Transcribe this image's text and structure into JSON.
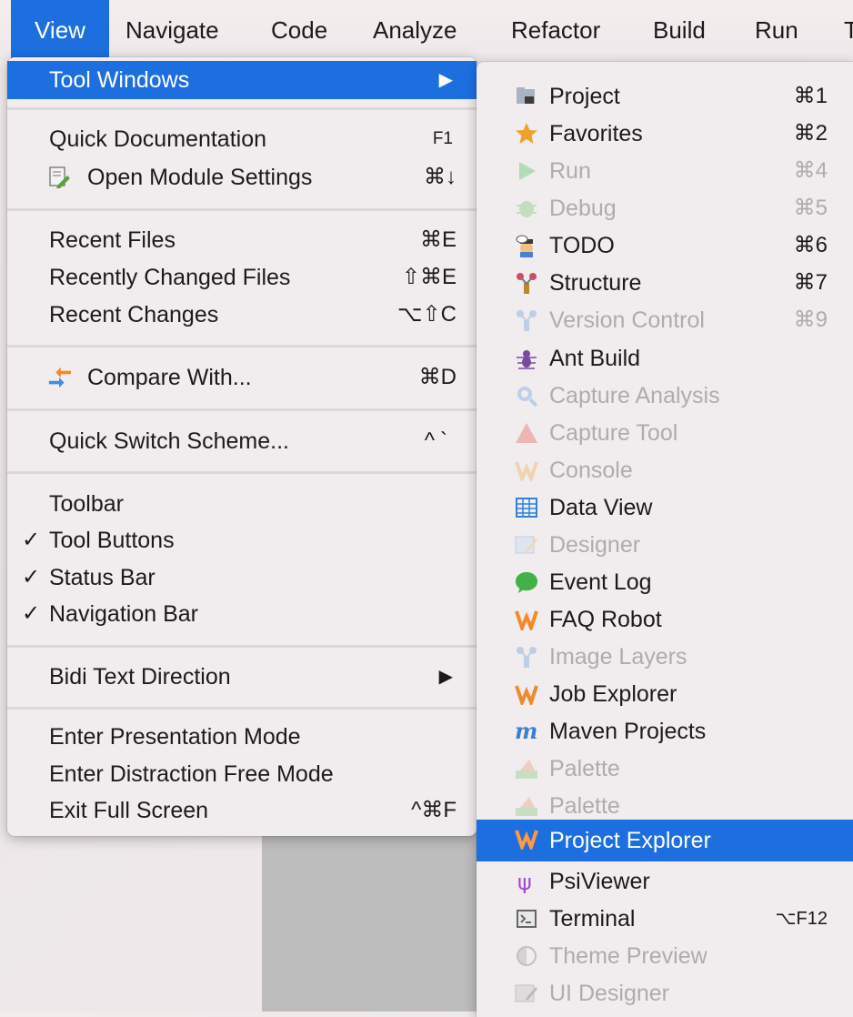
{
  "menubar": {
    "items": [
      "View",
      "Navigate",
      "Code",
      "Analyze",
      "Refactor",
      "Build",
      "Run",
      "T"
    ]
  },
  "view_menu": {
    "tool_windows": {
      "label": "Tool Windows"
    },
    "quick_documentation": {
      "label": "Quick Documentation",
      "shortcut": "F1"
    },
    "open_module_settings": {
      "label": "Open Module Settings",
      "shortcut": "⌘↓"
    },
    "recent_files": {
      "label": "Recent Files",
      "shortcut": "⌘E"
    },
    "recently_changed_files": {
      "label": "Recently Changed Files",
      "shortcut": "⇧⌘E"
    },
    "recent_changes": {
      "label": "Recent Changes",
      "shortcut": "⌥⇧C"
    },
    "compare_with": {
      "label": "Compare With...",
      "shortcut": "⌘D"
    },
    "quick_switch_scheme": {
      "label": "Quick Switch Scheme...",
      "shortcut": "^`"
    },
    "toolbar": {
      "label": "Toolbar"
    },
    "tool_buttons": {
      "label": "Tool Buttons",
      "checked": true
    },
    "status_bar": {
      "label": "Status Bar",
      "checked": true
    },
    "navigation_bar": {
      "label": "Navigation Bar",
      "checked": true
    },
    "bidi_text_direction": {
      "label": "Bidi Text Direction"
    },
    "enter_presentation_mode": {
      "label": "Enter Presentation Mode"
    },
    "enter_distraction_free_mode": {
      "label": "Enter Distraction Free Mode"
    },
    "exit_full_screen": {
      "label": "Exit Full Screen",
      "shortcut": "^⌘F"
    },
    "check_glyph": "✓",
    "submenu_arrow": "▶"
  },
  "tool_windows_menu": {
    "items": [
      {
        "label": "Project",
        "shortcut": "⌘1",
        "enabled": true,
        "icon": "project-icon"
      },
      {
        "label": "Favorites",
        "shortcut": "⌘2",
        "enabled": true,
        "icon": "star-icon"
      },
      {
        "label": "Run",
        "shortcut": "⌘4",
        "enabled": false,
        "icon": "run-icon"
      },
      {
        "label": "Debug",
        "shortcut": "⌘5",
        "enabled": false,
        "icon": "bug-icon"
      },
      {
        "label": "TODO",
        "shortcut": "⌘6",
        "enabled": true,
        "icon": "todo-icon"
      },
      {
        "label": "Structure",
        "shortcut": "⌘7",
        "enabled": true,
        "icon": "structure-icon"
      },
      {
        "label": "Version Control",
        "shortcut": "⌘9",
        "enabled": false,
        "icon": "vcs-icon"
      },
      {
        "label": "Ant Build",
        "shortcut": "",
        "enabled": true,
        "icon": "ant-icon"
      },
      {
        "label": "Capture Analysis",
        "shortcut": "",
        "enabled": false,
        "icon": "magnifier-icon"
      },
      {
        "label": "Capture Tool",
        "shortcut": "",
        "enabled": false,
        "icon": "warning-icon"
      },
      {
        "label": "Console",
        "shortcut": "",
        "enabled": false,
        "icon": "console-icon"
      },
      {
        "label": "Data View",
        "shortcut": "",
        "enabled": true,
        "icon": "table-icon"
      },
      {
        "label": "Designer",
        "shortcut": "",
        "enabled": false,
        "icon": "designer-icon"
      },
      {
        "label": "Event Log",
        "shortcut": "",
        "enabled": true,
        "icon": "event-log-icon"
      },
      {
        "label": "FAQ Robot",
        "shortcut": "",
        "enabled": true,
        "icon": "robot-icon"
      },
      {
        "label": "Image Layers",
        "shortcut": "",
        "enabled": false,
        "icon": "image-layers-icon"
      },
      {
        "label": "Job Explorer",
        "shortcut": "",
        "enabled": true,
        "icon": "job-explorer-icon"
      },
      {
        "label": "Maven Projects",
        "shortcut": "",
        "enabled": true,
        "icon": "maven-icon"
      },
      {
        "label": "Palette",
        "shortcut": "",
        "enabled": false,
        "icon": "palette-icon"
      },
      {
        "label": "Palette",
        "shortcut": "",
        "enabled": false,
        "icon": "palette-icon"
      },
      {
        "label": "Project Explorer",
        "shortcut": "",
        "enabled": true,
        "icon": "project-explorer-icon",
        "highlighted": true
      },
      {
        "label": "PsiViewer",
        "shortcut": "",
        "enabled": true,
        "icon": "psi-icon"
      },
      {
        "label": "Terminal",
        "shortcut": "⌥F12",
        "enabled": true,
        "icon": "terminal-icon"
      },
      {
        "label": "Theme Preview",
        "shortcut": "",
        "enabled": false,
        "icon": "theme-icon"
      },
      {
        "label": "UI Designer",
        "shortcut": "",
        "enabled": false,
        "icon": "ui-designer-icon"
      }
    ]
  },
  "colors": {
    "highlight": "#1d6fe0",
    "disabled_text": "#b0abad"
  }
}
